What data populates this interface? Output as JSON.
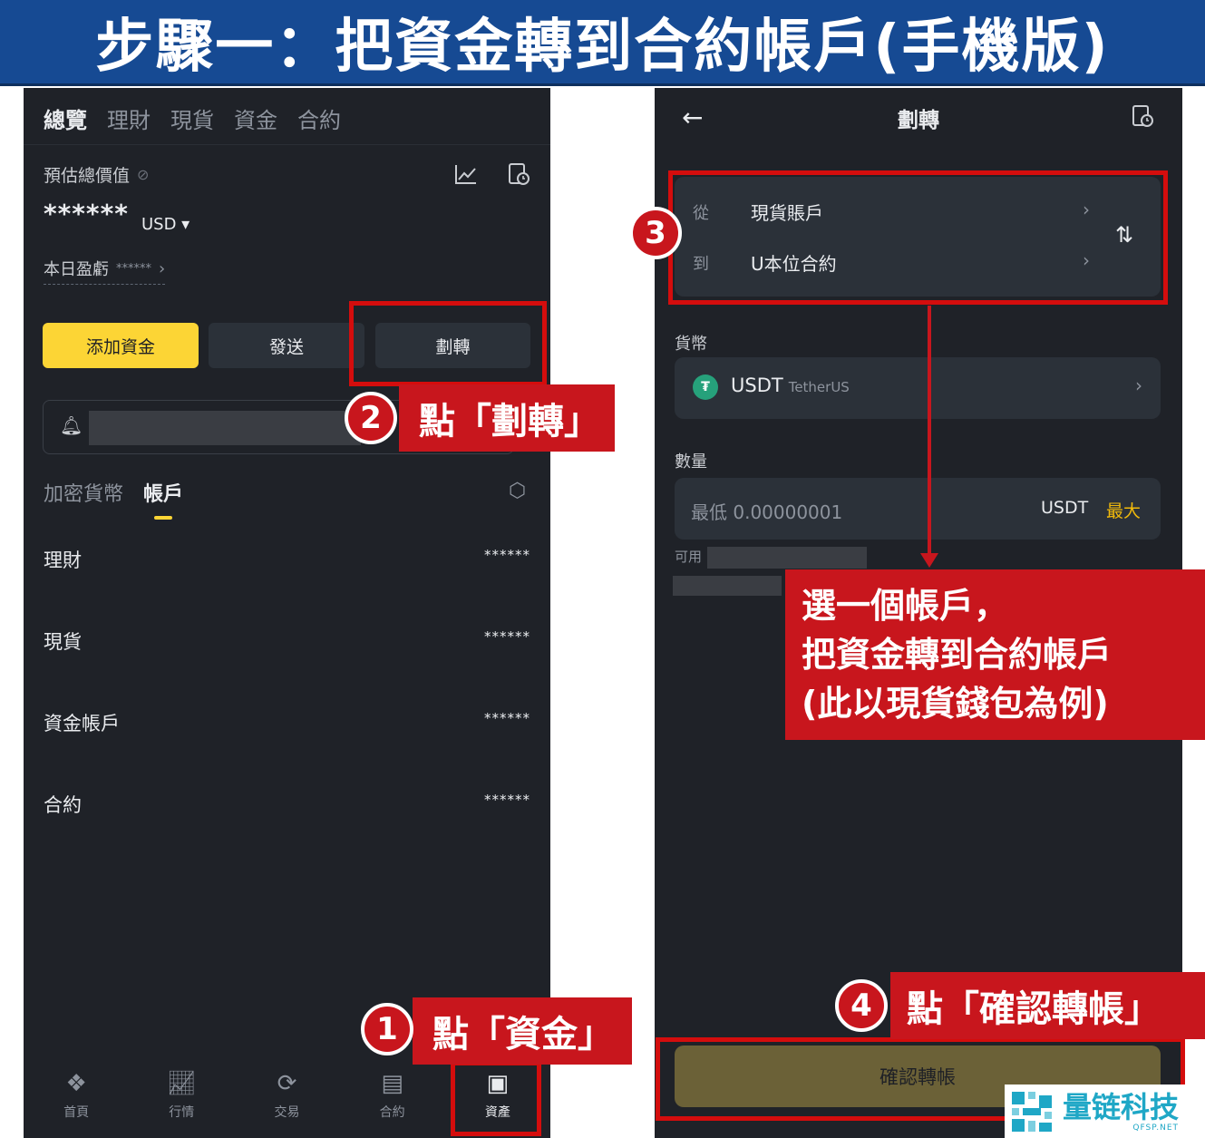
{
  "banner": {
    "title": "步驟一：把資金轉到合約帳戶(手機版)"
  },
  "left": {
    "top_tabs": [
      "總覽",
      "理財",
      "現貨",
      "資金",
      "合約"
    ],
    "est_label": "預估總價值",
    "balance_mask": "******",
    "currency": "USD ▾",
    "daily_pnl_label": "本日盈虧",
    "daily_pnl_mask": "******",
    "buttons": {
      "add_funds": "添加資金",
      "send": "發送",
      "transfer": "劃轉"
    },
    "sub_tabs": [
      "加密貨幣",
      "帳戶"
    ],
    "accounts": [
      {
        "name": "理財",
        "value": "******"
      },
      {
        "name": "現貨",
        "value": "******"
      },
      {
        "name": "資金帳戶",
        "value": "******"
      },
      {
        "name": "合約",
        "value": "******"
      }
    ],
    "nav": [
      {
        "label": "首頁",
        "icon": "home-icon"
      },
      {
        "label": "行情",
        "icon": "chart-icon"
      },
      {
        "label": "交易",
        "icon": "trade-icon"
      },
      {
        "label": "合約",
        "icon": "futures-icon"
      },
      {
        "label": "資產",
        "icon": "wallet-icon"
      }
    ]
  },
  "right": {
    "title": "劃轉",
    "from_label": "從",
    "from_value": "現貨賬戶",
    "to_label": "到",
    "to_value": "U本位合約",
    "currency_label": "貨幣",
    "coin": "USDT",
    "coin_name": "TetherUS",
    "amount_label": "數量",
    "amount_placeholder": "最低 0.00000001",
    "amount_unit": "USDT",
    "max_label": "最大",
    "available_label": "可用",
    "confirm_button": "確認轉帳"
  },
  "annotations": {
    "step1_num": "1",
    "step1_text": "點「資金」",
    "step2_num": "2",
    "step2_text": "點「劃轉」",
    "step3_num": "3",
    "step3_lines": [
      "選一個帳戶，",
      "把資金轉到合約帳戶",
      "(此以現貨錢包為例)"
    ],
    "step4_num": "4",
    "step4_text": "點「確認轉帳」",
    "color": "#c8161d"
  },
  "logo": {
    "cn": "量链科技",
    "en": "QFSP.NET"
  }
}
